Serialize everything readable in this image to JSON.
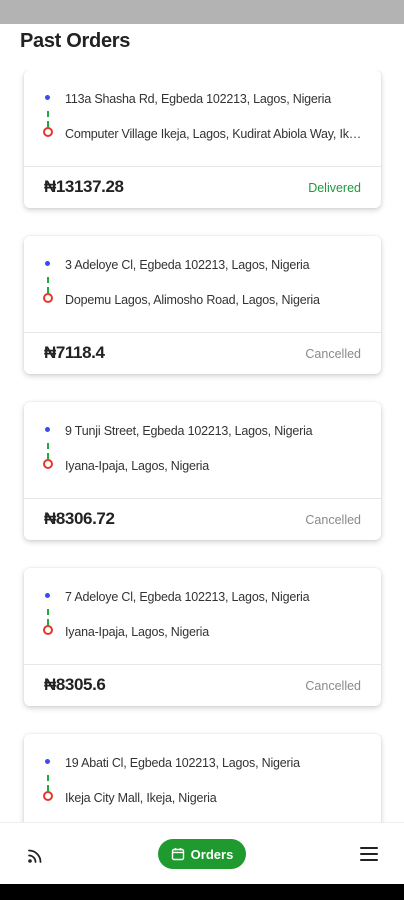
{
  "page": {
    "title": "Past Orders"
  },
  "orders": [
    {
      "pickup": "113a Shasha Rd, Egbeda 102213, Lagos, Nigeria",
      "dropoff": "Computer Village Ikeja, Lagos, Kudirat Abiola Way, Ikeja, ...",
      "price": "₦13137.28",
      "status": "Delivered"
    },
    {
      "pickup": "3 Adeloye Cl, Egbeda 102213, Lagos, Nigeria",
      "dropoff": "Dopemu Lagos, Alimosho Road, Lagos, Nigeria",
      "price": "₦7118.4",
      "status": "Cancelled"
    },
    {
      "pickup": "9 Tunji Street, Egbeda 102213, Lagos, Nigeria",
      "dropoff": "Iyana-Ipaja, Lagos, Nigeria",
      "price": "₦8306.72",
      "status": "Cancelled"
    },
    {
      "pickup": "7 Adeloye Cl, Egbeda 102213, Lagos, Nigeria",
      "dropoff": "Iyana-Ipaja, Lagos, Nigeria",
      "price": "₦8305.6",
      "status": "Cancelled"
    },
    {
      "pickup": "19 Abati Cl, Egbeda 102213, Lagos, Nigeria",
      "dropoff": "Ikeja City Mall, Ikeja, Nigeria",
      "price": "",
      "status": ""
    }
  ],
  "nav": {
    "orders_label": "Orders",
    "feed_icon": "rss-feed-icon",
    "orders_icon": "calendar-icon",
    "menu_icon": "hamburger-menu-icon"
  },
  "colors": {
    "accent_green": "#1e9a2e",
    "delivered": "#1e9a3e",
    "cancelled": "#8a8a8a",
    "pickup_dot": "#3b4bf0",
    "dropoff_ring": "#e5372d"
  }
}
